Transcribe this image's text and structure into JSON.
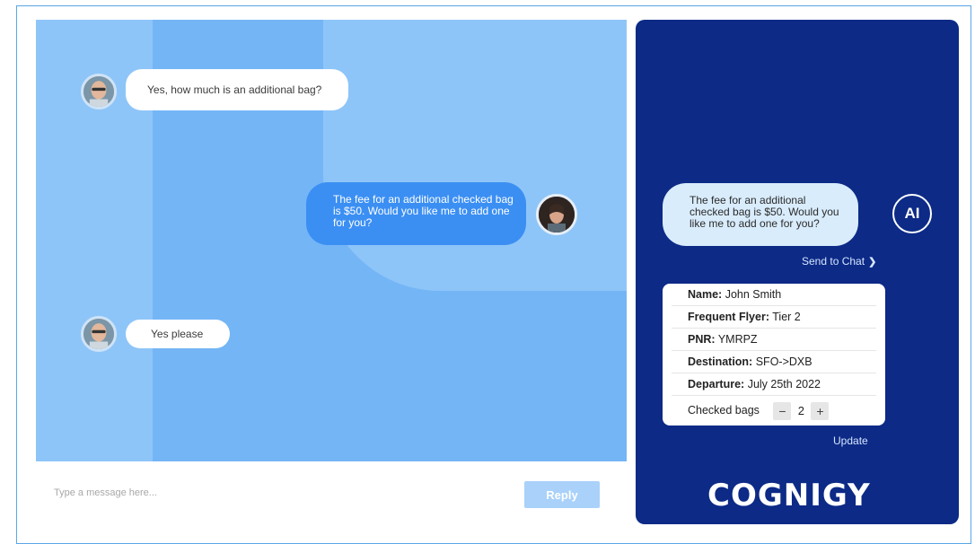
{
  "chat": {
    "messages": [
      {
        "role": "customer",
        "text": "Yes, how much is an additional bag?"
      },
      {
        "role": "agent",
        "text": "The fee for an additional checked bag is $50. Would you like me to add one for you?"
      },
      {
        "role": "customer",
        "text": "Yes please"
      }
    ],
    "composer": {
      "placeholder": "Type a message here...",
      "reply_label": "Reply"
    }
  },
  "ai_panel": {
    "suggestion": "The fee for an additional checked bag is $50. Would you like me to add one for you?",
    "ai_logo": "AI",
    "send_to_chat": "Send to Chat",
    "send_icon": "chevron-right-icon",
    "details": [
      {
        "label": "Name:",
        "value": "John Smith"
      },
      {
        "label": "Frequent Flyer:",
        "value": "Tier 2"
      },
      {
        "label": "PNR:",
        "value": "YMRPZ"
      },
      {
        "label": "Destination:",
        "value": "SFO->DXB"
      },
      {
        "label": "Departure:",
        "value": "July 25th 2022"
      }
    ],
    "checked_bags": {
      "label": "Checked bags",
      "value": "2",
      "minus": "−",
      "plus": "+"
    },
    "update_label": "Update",
    "brand": "COGNIGY"
  },
  "colors": {
    "chat_bg": "#74b5f6",
    "agent_bubble": "#3b8ff3",
    "ai_panel_bg": "#0c2a86",
    "reply_button": "#a9d1fa"
  }
}
